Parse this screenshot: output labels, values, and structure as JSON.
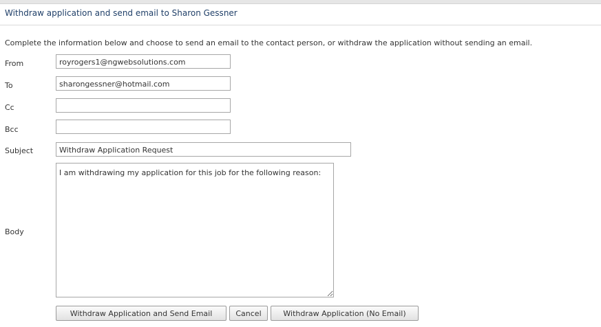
{
  "dialog": {
    "title": "Withdraw application and send email to Sharon Gessner",
    "intro": "Complete the information below and choose to send an email to the contact person, or withdraw the application without sending an email."
  },
  "form": {
    "from": {
      "label": "From",
      "value": "royrogers1@ngwebsolutions.com"
    },
    "to": {
      "label": "To",
      "value": "sharongessner@hotmail.com"
    },
    "cc": {
      "label": "Cc",
      "value": ""
    },
    "bcc": {
      "label": "Bcc",
      "value": ""
    },
    "subject": {
      "label": "Subject",
      "value": "Withdraw Application Request"
    },
    "body": {
      "label": "Body",
      "value": "I am withdrawing my application for this job for the following reason:"
    }
  },
  "buttons": {
    "withdraw_send": "Withdraw Application and Send Email",
    "cancel": "Cancel",
    "withdraw_no_email": "Withdraw Application (No Email)"
  }
}
